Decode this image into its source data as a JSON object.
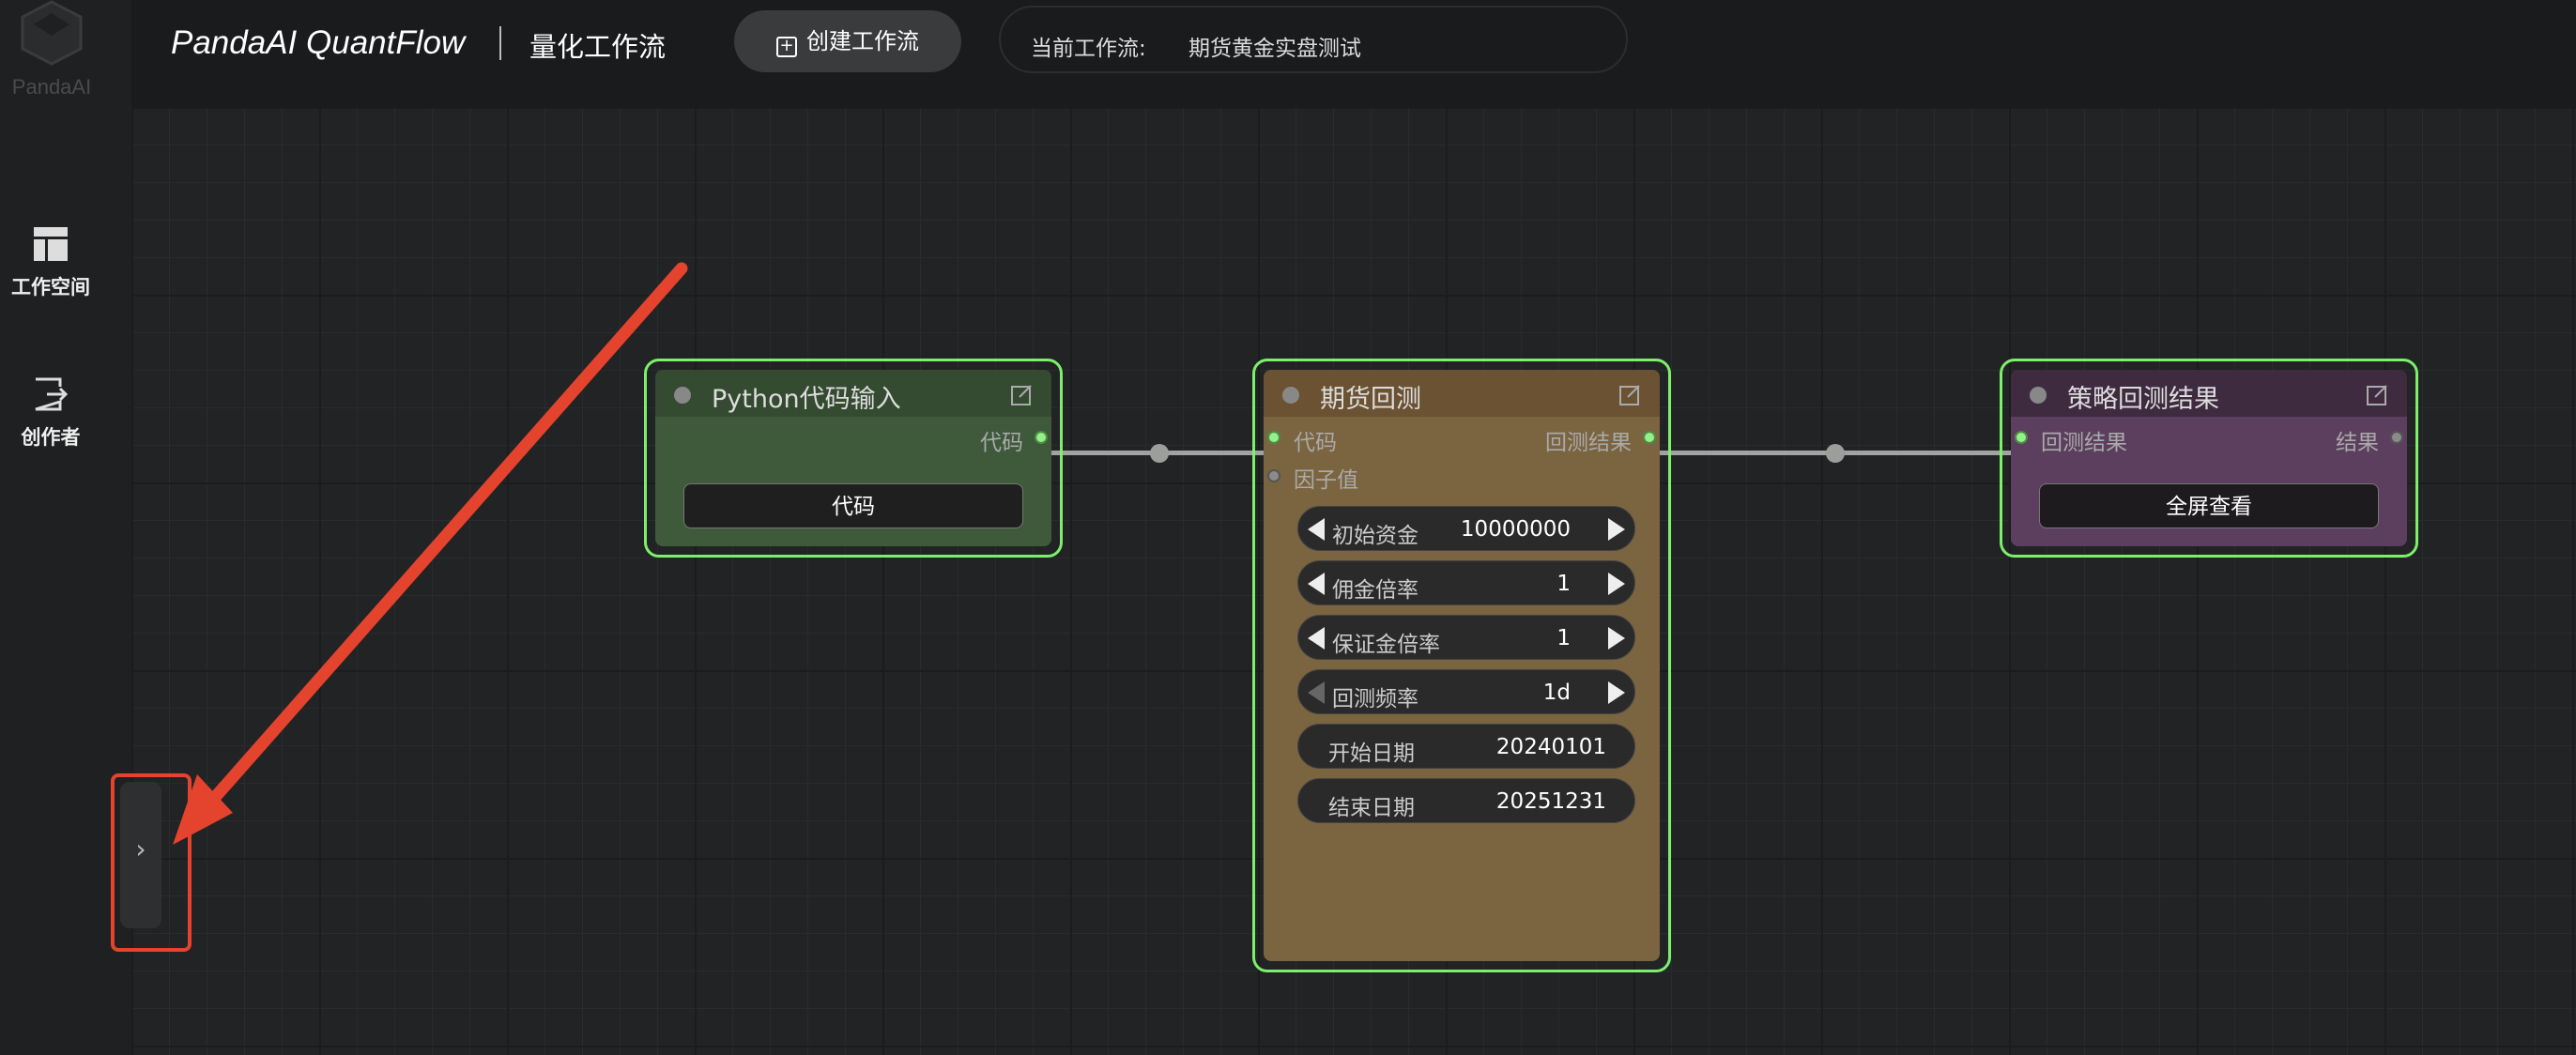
{
  "sidebar": {
    "logo_text": "PandaAI",
    "items": [
      {
        "label": "工作空间",
        "icon": "workspace-icon"
      },
      {
        "label": "创作者",
        "icon": "creator-icon"
      }
    ],
    "collapse_label": "›"
  },
  "header": {
    "brand": "PandaAI QuantFlow",
    "subtitle": "量化工作流",
    "create_button": "创建工作流",
    "current_workflow_label": "当前工作流:",
    "current_workflow_value": "期货黄金实盘测试"
  },
  "nodes": {
    "python_input": {
      "title": "Python代码输入",
      "output_label": "代码",
      "button_label": "代码"
    },
    "futures_backtest": {
      "title": "期货回测",
      "inputs": [
        "代码",
        "因子值"
      ],
      "output_label": "回测结果",
      "params": [
        {
          "key": "初始资金",
          "value": "10000000"
        },
        {
          "key": "佣金倍率",
          "value": "1"
        },
        {
          "key": "保证金倍率",
          "value": "1"
        },
        {
          "key": "回测频率",
          "value": "1d"
        },
        {
          "key": "开始日期",
          "value": "20240101"
        },
        {
          "key": "结束日期",
          "value": "20251231"
        }
      ]
    },
    "strategy_result": {
      "title": "策略回测结果",
      "input_label": "回测结果",
      "output_label": "结果",
      "button_label": "全屏查看"
    }
  },
  "colors": {
    "node_border": "#7cf06a",
    "python_node": "#3e5a3b",
    "backtest_node": "#7b6440",
    "result_node": "#5c3f5e",
    "highlight": "#e4432d"
  }
}
